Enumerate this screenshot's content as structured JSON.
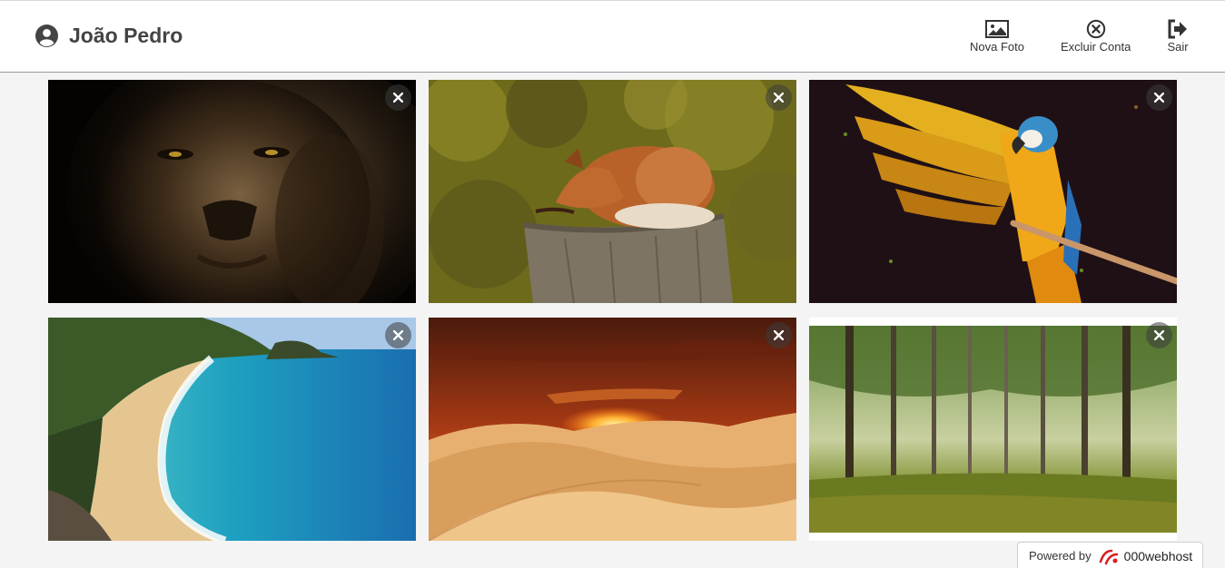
{
  "user": {
    "name": "João Pedro",
    "icon": "user-circle-icon"
  },
  "actions": [
    {
      "label": "Nova Foto",
      "icon": "image-icon"
    },
    {
      "label": "Excluir Conta",
      "icon": "circle-x-icon"
    },
    {
      "label": "Sair",
      "icon": "sign-out-icon"
    }
  ],
  "gallery": [
    {
      "subject": "lion"
    },
    {
      "subject": "fox"
    },
    {
      "subject": "macaw"
    },
    {
      "subject": "beach"
    },
    {
      "subject": "desert"
    },
    {
      "subject": "forest"
    }
  ],
  "badge": {
    "prefix": "Powered by",
    "brand": "000webhost"
  },
  "colors": {
    "header_bg": "#ffffff",
    "page_bg": "#f4f4f4",
    "text": "#444444",
    "badge_red": "#d81f26"
  }
}
